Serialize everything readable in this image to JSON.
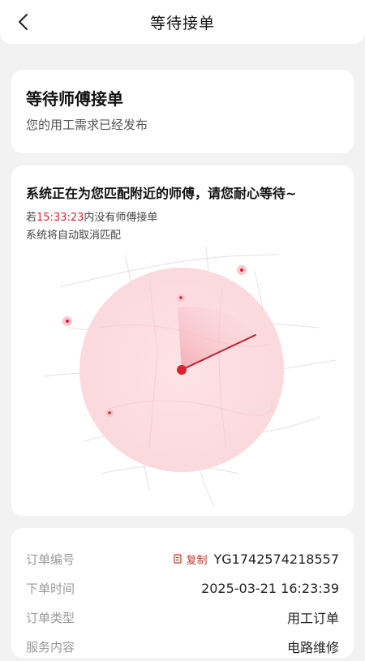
{
  "header": {
    "title": "等待接单"
  },
  "status": {
    "title": "等待师傅接单",
    "subtitle": "您的用工需求已经发布"
  },
  "matching": {
    "headline": "系统正在为您匹配附近的师傅，请您耐心等待~",
    "timer_prefix": "若",
    "timer_value": "15:33:23",
    "timer_suffix": "内没有师傅接单",
    "cancel_note": "系统将自动取消匹配",
    "accent_color": "#d9232e"
  },
  "order": {
    "copy_label": "复制",
    "rows": [
      {
        "label": "订单编号",
        "value": "YG1742574218557"
      },
      {
        "label": "下单时间",
        "value": "2025-03-21 16:23:39"
      },
      {
        "label": "订单类型",
        "value": "用工订单"
      },
      {
        "label": "服务内容",
        "value": "电路维修"
      }
    ]
  }
}
